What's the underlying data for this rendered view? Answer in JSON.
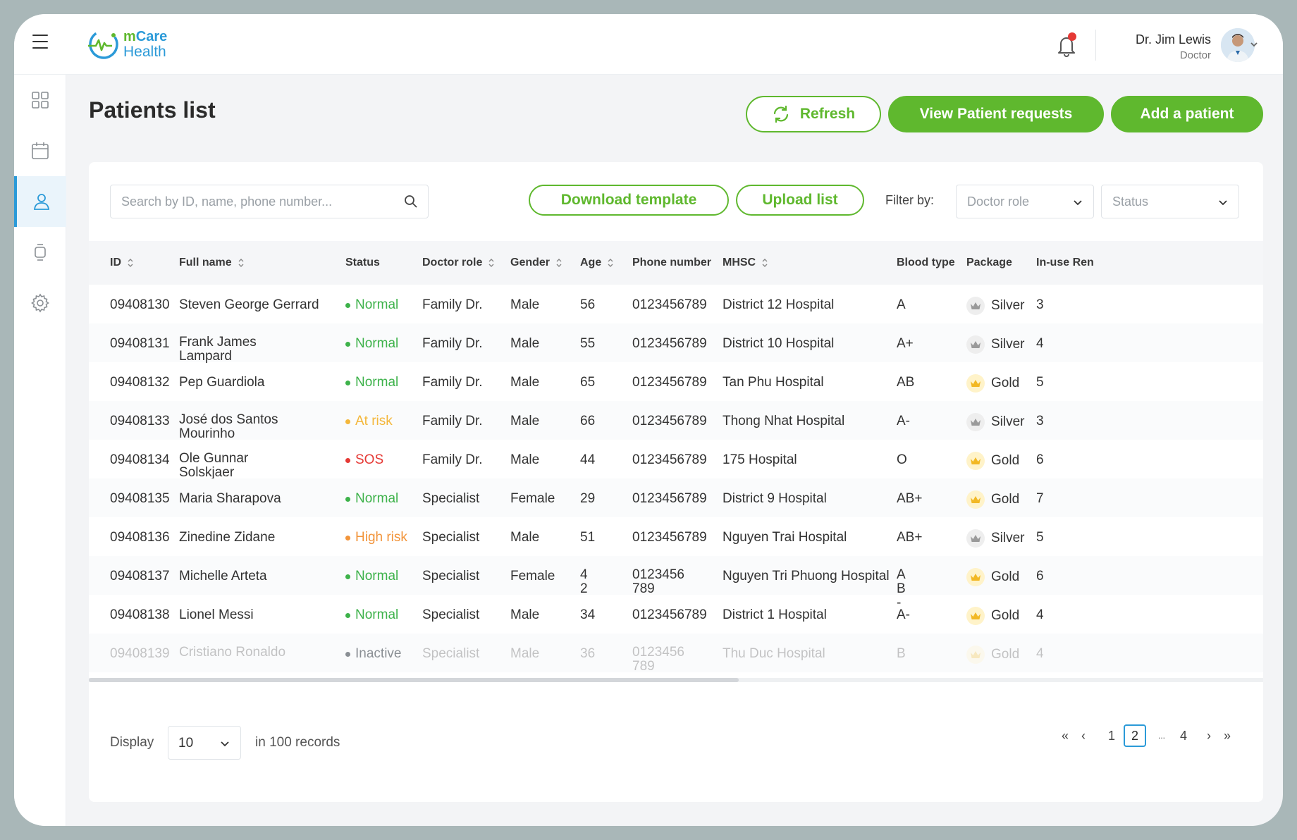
{
  "app": {
    "logo_line1_a": "m",
    "logo_line1_b": "Care",
    "logo_line2": "Health"
  },
  "user": {
    "name": "Dr. Jim Lewis",
    "role": "Doctor"
  },
  "page": {
    "title": "Patients list"
  },
  "actions": {
    "refresh": "Refresh",
    "view_requests": "View Patient requests",
    "add_patient": "Add a patient"
  },
  "toolbar": {
    "search_placeholder": "Search by ID, name, phone number...",
    "download_template": "Download template",
    "upload_list": "Upload list",
    "filter_label": "Filter by:",
    "doctor_role_placeholder": "Doctor role",
    "status_placeholder": "Status"
  },
  "columns": [
    "ID",
    "Full name",
    "Status",
    "Doctor role",
    "Gender",
    "Age",
    "Phone number",
    "MHSC",
    "Blood type",
    "Package",
    "In-use Ren"
  ],
  "status_colors": {
    "Normal": "#3db24a",
    "At risk": "#f4b73b",
    "SOS": "#e53935",
    "High risk": "#f2943a",
    "Inactive": "#8a8f94"
  },
  "rows": [
    {
      "id": "09408130",
      "name": "Steven George Gerrard",
      "status": "Normal",
      "role": "Family Dr.",
      "gender": "Male",
      "age": "56",
      "phone": "0123456789",
      "mhsc": "District 12 Hospital",
      "blood": "A",
      "package": "Silver",
      "inuse": "3"
    },
    {
      "id": "09408131",
      "name": "Frank James Lampard",
      "status": "Normal",
      "role": "Family Dr.",
      "gender": "Male",
      "age": "55",
      "phone": "0123456789",
      "mhsc": "District 10 Hospital",
      "blood": "A+",
      "package": "Silver",
      "inuse": "4"
    },
    {
      "id": "09408132",
      "name": "Pep Guardiola",
      "status": "Normal",
      "role": "Family Dr.",
      "gender": "Male",
      "age": "65",
      "phone": "0123456789",
      "mhsc": "Tan Phu Hospital",
      "blood": "AB",
      "package": "Gold",
      "inuse": "5"
    },
    {
      "id": "09408133",
      "name": "José dos Santos Mourinho",
      "status": "At risk",
      "role": "Family Dr.",
      "gender": "Male",
      "age": "66",
      "phone": "0123456789",
      "mhsc": "Thong Nhat Hospital",
      "blood": "A-",
      "package": "Silver",
      "inuse": "3"
    },
    {
      "id": "09408134",
      "name": "Ole Gunnar Solskjaer",
      "status": "SOS",
      "role": "Family Dr.",
      "gender": "Male",
      "age": "44",
      "phone": "0123456789",
      "mhsc": "175 Hospital",
      "blood": "O",
      "package": "Gold",
      "inuse": "6"
    },
    {
      "id": "09408135",
      "name": "Maria Sharapova",
      "status": "Normal",
      "role": "Specialist",
      "gender": "Female",
      "age": "29",
      "phone": "0123456789",
      "mhsc": "District 9 Hospital",
      "blood": "AB+",
      "package": "Gold",
      "inuse": "7"
    },
    {
      "id": "09408136",
      "name": "Zinedine Zidane",
      "status": "High risk",
      "role": "Specialist",
      "gender": "Male",
      "age": "51",
      "phone": "0123456789",
      "mhsc": "Nguyen Trai Hospital",
      "blood": "AB+",
      "package": "Silver",
      "inuse": "5"
    },
    {
      "id": "09408137",
      "name": "Michelle Arteta",
      "status": "Normal",
      "role": "Specialist",
      "gender": "Female",
      "age": "42",
      "phone": "0123456789",
      "mhsc": "Nguyen Tri Phuong Hospital",
      "blood": "AB-",
      "package": "Gold",
      "inuse": "6"
    },
    {
      "id": "09408138",
      "name": "Lionel Messi",
      "status": "Normal",
      "role": "Specialist",
      "gender": "Male",
      "age": "34",
      "phone": "0123456789",
      "mhsc": "District 1 Hospital",
      "blood": "A-",
      "package": "Gold",
      "inuse": "4"
    },
    {
      "id": "09408139",
      "name": "Cristiano Ronaldo",
      "status": "Inactive",
      "role": "Specialist",
      "gender": "Male",
      "age": "36",
      "phone": "0123456789",
      "mhsc": "Thu Duc Hospital",
      "blood": "B",
      "package": "Gold",
      "inuse": "4"
    }
  ],
  "footer": {
    "display_label": "Display",
    "page_size": "10",
    "records_text": "in 100 records"
  },
  "pagination": {
    "first": "«",
    "prev": "‹",
    "pages": [
      "1",
      "2",
      "...",
      "4"
    ],
    "current": "2",
    "next": "›",
    "last": "»"
  }
}
